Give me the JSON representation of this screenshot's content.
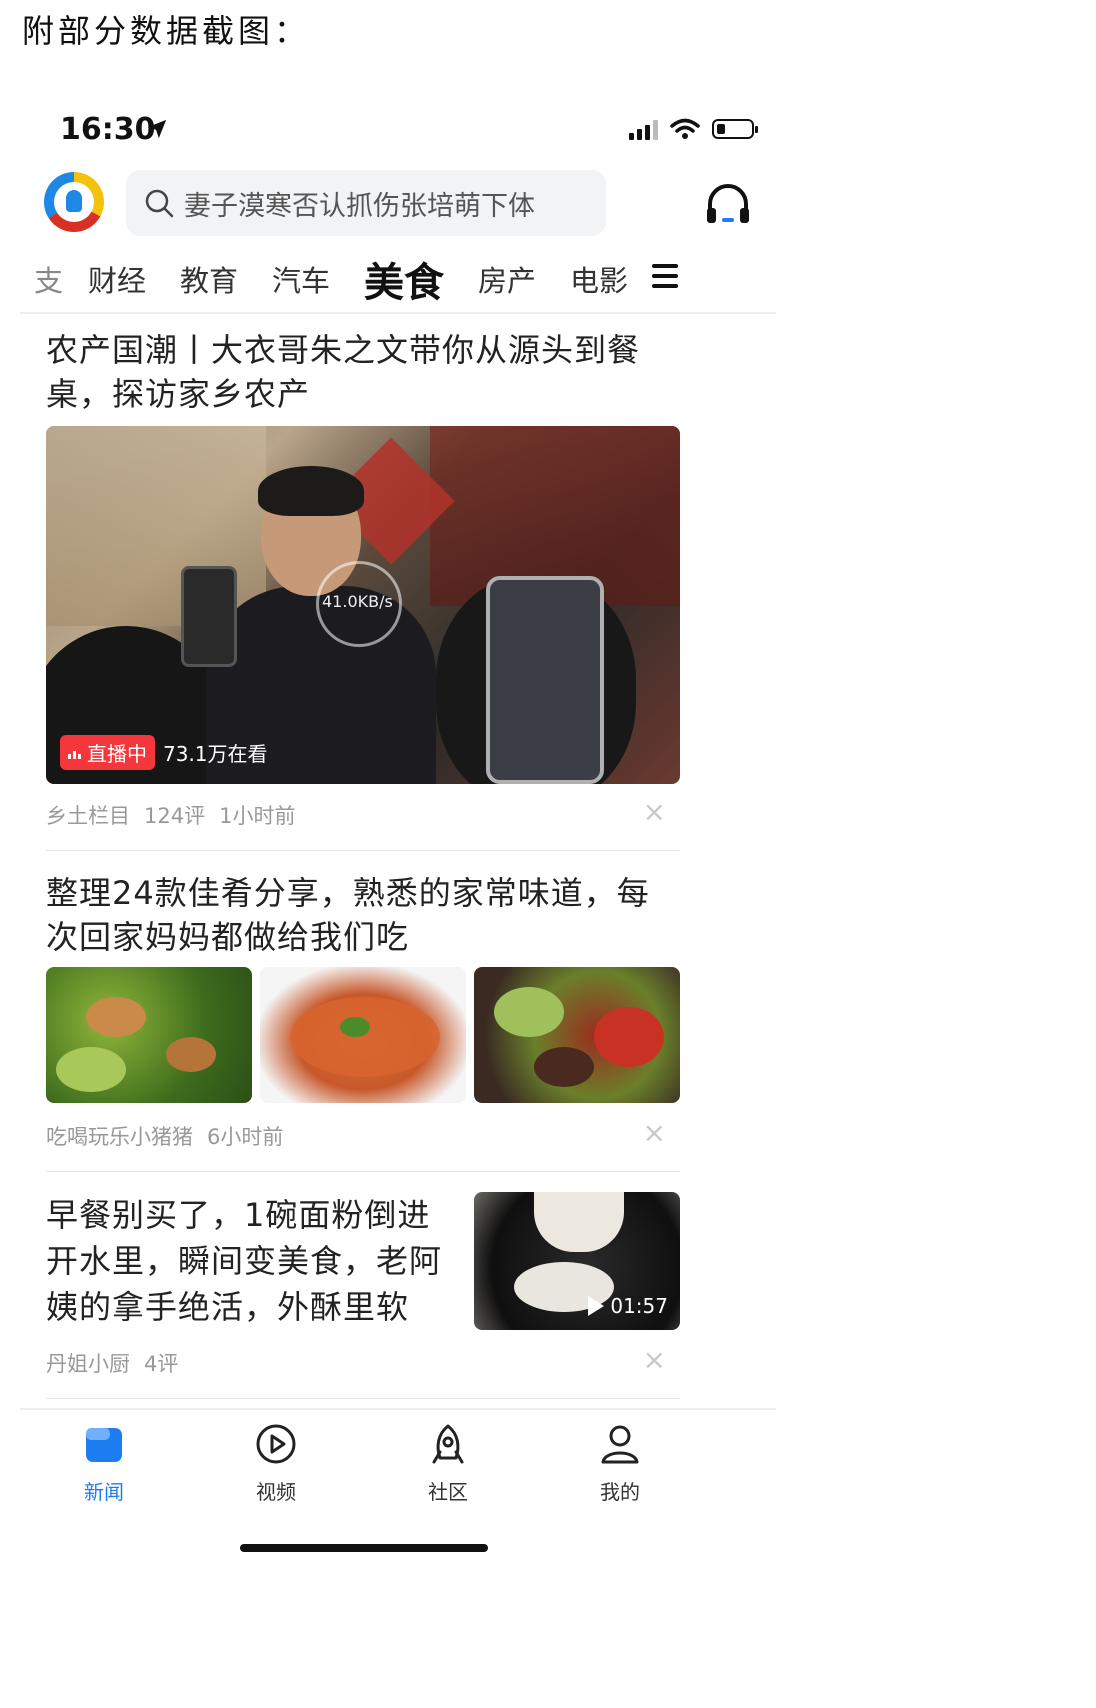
{
  "caption": "附部分数据截图：",
  "status_bar": {
    "time": "16:30"
  },
  "header": {
    "search_placeholder": "妻子漠寒否认抓伤张培萌下体"
  },
  "tabs": [
    {
      "label": "支"
    },
    {
      "label": "财经"
    },
    {
      "label": "教育"
    },
    {
      "label": "汽车"
    },
    {
      "label": "美食",
      "active": true
    },
    {
      "label": "房产"
    },
    {
      "label": "电影"
    }
  ],
  "feed": {
    "article1": {
      "title": "农产国潮丨大衣哥朱之文带你从源头到餐桌，探访家乡农产",
      "loading_speed": "41.0KB/s",
      "live_label": "直播中",
      "viewer_count": "73.1万在看",
      "source": "乡土栏目",
      "comments": "124评",
      "time": "1小时前"
    },
    "article2": {
      "title": "整理24款佳肴分享，熟悉的家常味道，每次回家妈妈都做给我们吃",
      "source": "吃喝玩乐小猪猪",
      "time": "6小时前"
    },
    "article3": {
      "title": "早餐别买了，1碗面粉倒进开水里，瞬间变美食，老阿姨的拿手绝活，外酥里软",
      "duration": "01:57",
      "source": "丹姐小厨",
      "comments": "4评"
    },
    "close_glyph": "×"
  },
  "bottom_nav": [
    {
      "label": "新闻",
      "icon": "news-icon",
      "active": true
    },
    {
      "label": "视频",
      "icon": "video-play-icon"
    },
    {
      "label": "社区",
      "icon": "community-icon"
    },
    {
      "label": "我的",
      "icon": "profile-icon"
    }
  ],
  "colors": {
    "accent": "#1d7cf2",
    "live_red": "#f4373c"
  }
}
